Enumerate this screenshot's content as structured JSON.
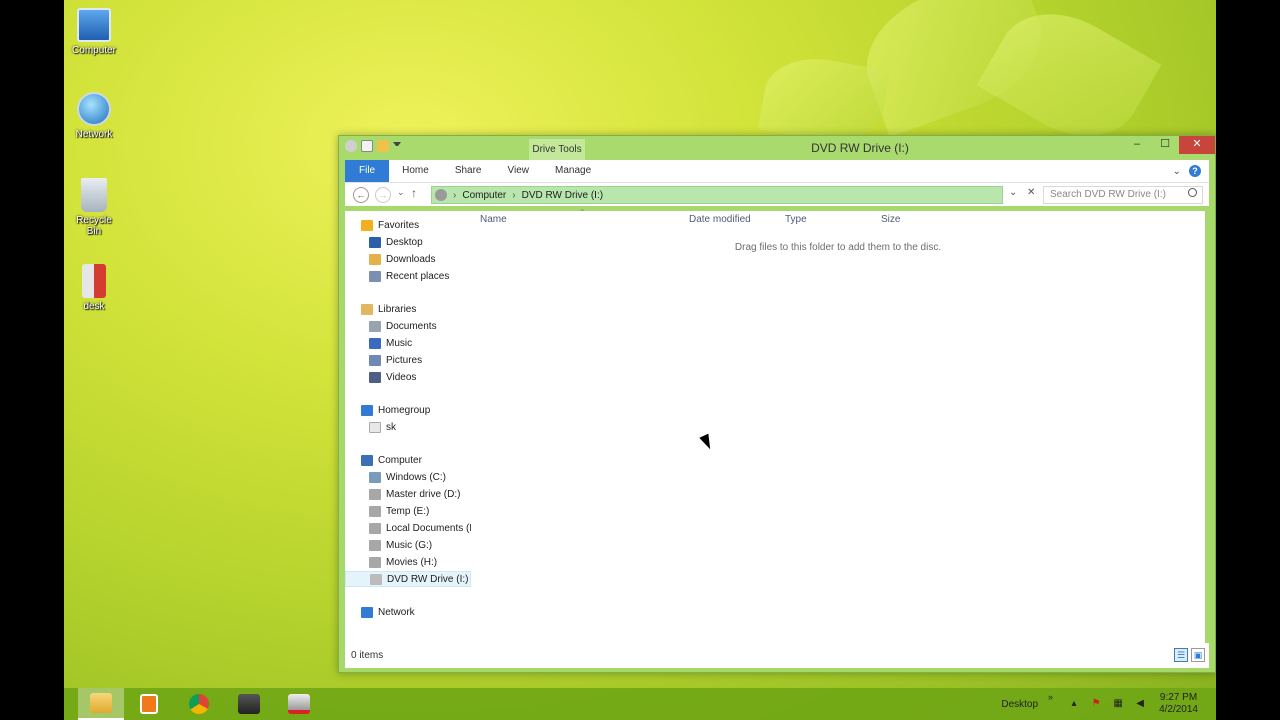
{
  "desktop": {
    "icons": [
      {
        "label": "Computer"
      },
      {
        "label": "Network"
      },
      {
        "label": "Recycle Bin"
      },
      {
        "label": "desk"
      }
    ]
  },
  "window": {
    "title": "DVD RW Drive (I:)",
    "context_tab": "Drive Tools",
    "window_buttons": {
      "minimize": "–",
      "maximize": "☐",
      "close": "✕"
    },
    "ribbon_tabs": [
      "File",
      "Home",
      "Share",
      "View",
      "Manage"
    ],
    "address": {
      "segments": [
        "Computer",
        "DVD RW Drive (I:)"
      ]
    },
    "search_placeholder": "Search DVD RW Drive (I:)",
    "nav_pane": [
      {
        "label": "Favorites",
        "icon": "star-icon",
        "color": "#f2b01e"
      },
      {
        "label": "Desktop",
        "icon": "desktop-icon",
        "color": "#2b5fa8"
      },
      {
        "label": "Downloads",
        "icon": "downloads-icon",
        "color": "#e3b24a"
      },
      {
        "label": "Recent places",
        "icon": "recent-places-icon",
        "color": "#7b8fb0"
      },
      {
        "label": "Libraries",
        "icon": "libraries-icon",
        "color": "#e1b860"
      },
      {
        "label": "Documents",
        "icon": "documents-icon",
        "color": "#9aa4b0"
      },
      {
        "label": "Music",
        "icon": "music-icon",
        "color": "#3c6ac2"
      },
      {
        "label": "Pictures",
        "icon": "pictures-icon",
        "color": "#6e8ab2"
      },
      {
        "label": "Videos",
        "icon": "videos-icon",
        "color": "#4d5f85"
      },
      {
        "label": "Homegroup",
        "icon": "homegroup-icon",
        "color": "#2f7bd5"
      },
      {
        "label": "sk",
        "icon": "user-file-icon",
        "color": "#e8e8e8"
      },
      {
        "label": "Computer",
        "icon": "computer-icon",
        "color": "#3b6fb6"
      },
      {
        "label": "Windows (C:)",
        "icon": "windows-drive-icon",
        "color": "#7a9bb9"
      },
      {
        "label": "Master drive (D:)",
        "icon": "drive-icon",
        "color": "#a7a7a7"
      },
      {
        "label": "Temp (E:)",
        "icon": "drive-icon",
        "color": "#a7a7a7"
      },
      {
        "label": "Local Documents (F:",
        "icon": "drive-icon",
        "color": "#a7a7a7"
      },
      {
        "label": "Music (G:)",
        "icon": "drive-icon",
        "color": "#a7a7a7"
      },
      {
        "label": "Movies (H:)",
        "icon": "drive-icon",
        "color": "#a7a7a7"
      },
      {
        "label": "DVD RW Drive (I:)",
        "icon": "dvd-drive-icon",
        "color": "#bbbbbb"
      },
      {
        "label": "Network",
        "icon": "network-icon",
        "color": "#2f7bd5"
      }
    ],
    "columns": [
      "Name",
      "Date modified",
      "Type",
      "Size"
    ],
    "empty_message": "Drag files to this folder to add them to the disc.",
    "status": "0 items"
  },
  "taskbar": {
    "tray_label": "Desktop",
    "time": "9:27 PM",
    "date": "4/2/2014"
  }
}
